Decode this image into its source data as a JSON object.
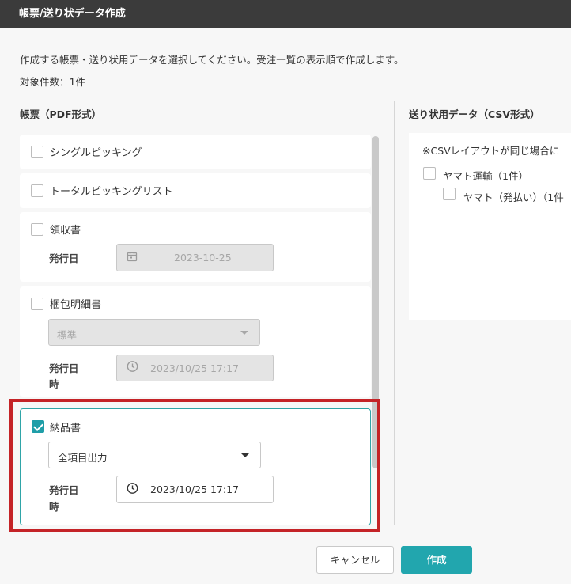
{
  "dialog": {
    "title": "帳票/送り状データ作成"
  },
  "description": "作成する帳票・送り状用データを選択してください。受注一覧の表示順で作成します。",
  "count_text": "対象件数：1件",
  "pdf_section": {
    "title": "帳票（PDF形式）",
    "cards": {
      "single_picking": {
        "label": "シングルピッキング",
        "checked": false
      },
      "total_picking": {
        "label": "トータルピッキングリスト",
        "checked": false
      },
      "receipt": {
        "label": "領収書",
        "checked": false,
        "date_label": "発行日",
        "date_value": "2023-10-25"
      },
      "packing_slip": {
        "label": "梱包明細書",
        "checked": false,
        "select_value": "標準",
        "datetime_label_1": "発行日",
        "datetime_label_2": "時",
        "datetime_value": "2023/10/25 17:17"
      },
      "delivery_note": {
        "label": "納品書",
        "checked": true,
        "select_value": "全項目出力",
        "datetime_label_1": "発行日",
        "datetime_label_2": "時",
        "datetime_value": "2023/10/25 17:17"
      }
    }
  },
  "csv_section": {
    "title": "送り状用データ（CSV形式）",
    "note": "※CSVレイアウトが同じ場合に",
    "carrier": {
      "label": "ヤマト運輸（1件）",
      "checked": false
    },
    "sub_carrier": {
      "label": "ヤマト（発払い）（1件",
      "checked": false
    }
  },
  "buttons": {
    "cancel": "キャンセル",
    "create": "作成"
  },
  "colors": {
    "accent": "#22a6ae",
    "titlebar": "#3b3b3b",
    "highlight": "#c42327",
    "background": "#f7f7f7"
  }
}
